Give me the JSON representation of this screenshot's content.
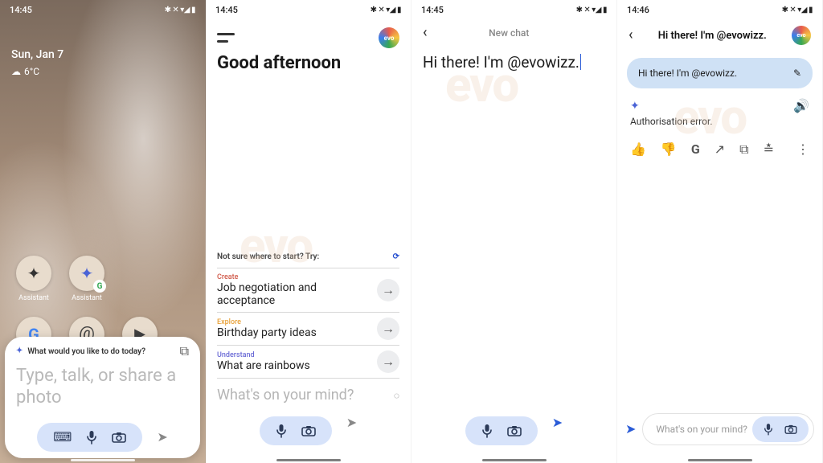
{
  "statusbar": {
    "time1": "14:45",
    "time2": "14:45",
    "time3": "14:45",
    "time4": "14:46",
    "indicators": "✱ ✕ ▾◢ ▮"
  },
  "panel1": {
    "date": "Sun, Jan 7",
    "temp": "6°C",
    "apps_row1": [
      {
        "name": "assistant-classic",
        "label": "Assistant"
      },
      {
        "name": "assistant-gemini",
        "label": "Assistant"
      }
    ],
    "apps_row2": [
      {
        "name": "google",
        "label": ""
      },
      {
        "name": "threads",
        "label": ""
      },
      {
        "name": "play",
        "label": ""
      }
    ],
    "sheet": {
      "prompt": "What would you like to do today?",
      "hero": "Type, talk, or share a photo"
    }
  },
  "panel2": {
    "greeting": "Good afternoon",
    "suggest_header": "Not sure where to start? Try:",
    "items": [
      {
        "tag_class": "tag-create",
        "tag": "Create",
        "line": "Job negotiation and acceptance"
      },
      {
        "tag_class": "tag-explore",
        "tag": "Explore",
        "line": "Birthday party ideas"
      },
      {
        "tag_class": "tag-understand",
        "tag": "Understand",
        "line": "What are rainbows"
      }
    ],
    "placeholder": "What's on your mind?"
  },
  "panel3": {
    "title": "New chat",
    "typed": "Hi there! I'm @evowizz."
  },
  "panel4": {
    "title": "Hi there! I'm @evowizz.",
    "user_msg": "Hi there! I'm @evowizz.",
    "error": "Authorisation error.",
    "placeholder": "What's on your mind?"
  },
  "watermark": "evo"
}
